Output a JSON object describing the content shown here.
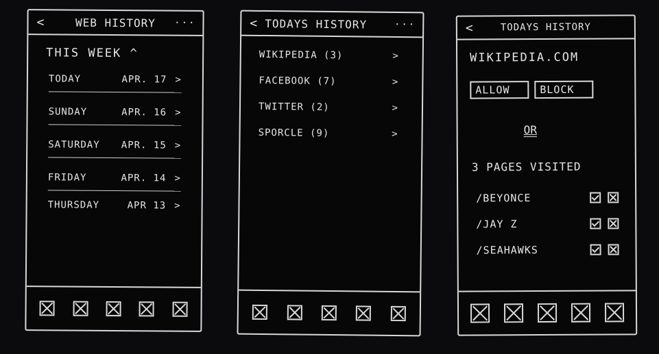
{
  "screen1": {
    "title": "WEB HISTORY",
    "back_label": "<",
    "more_label": "···",
    "week_label": "THIS WEEK ^",
    "days": [
      {
        "name": "TODAY",
        "date": "APR. 17"
      },
      {
        "name": "SUNDAY",
        "date": "APR. 16"
      },
      {
        "name": "SATURDAY",
        "date": "APR. 15"
      },
      {
        "name": "FRIDAY",
        "date": "APR. 14"
      },
      {
        "name": "THURSDAY",
        "date": "APR 13"
      }
    ],
    "chevron": ">",
    "tab_icons": [
      "placeholder-icon",
      "placeholder-icon",
      "placeholder-icon",
      "placeholder-icon",
      "placeholder-icon"
    ]
  },
  "screen2": {
    "title": "TODAYS HISTORY",
    "back_label": "<",
    "more_label": "···",
    "sites": [
      {
        "label": "WIKIPEDIA (3)"
      },
      {
        "label": "FACEBOOK (7)"
      },
      {
        "label": "TWITTER (2)"
      },
      {
        "label": "SPORCLE (9)"
      }
    ],
    "chevron": ">",
    "tab_icons": [
      "placeholder-icon",
      "placeholder-icon",
      "placeholder-icon",
      "placeholder-icon",
      "placeholder-icon"
    ]
  },
  "screen3": {
    "title": "TODAYS HISTORY",
    "back_label": "<",
    "domain": "WIKIPEDIA.COM",
    "allow_label": "ALLOW",
    "block_label": "BLOCK",
    "or_label": "OR",
    "visited_label": "3 PAGES VISITED",
    "pages": [
      {
        "path": "/BEYONCE"
      },
      {
        "path": "/JAY Z"
      },
      {
        "path": "/SEAHAWKS"
      }
    ],
    "tab_icons": [
      "placeholder-icon",
      "placeholder-icon",
      "placeholder-icon",
      "placeholder-icon",
      "placeholder-icon"
    ]
  },
  "colors": {
    "background": "#0b0b0d",
    "chalk": "#d9d9d9"
  }
}
